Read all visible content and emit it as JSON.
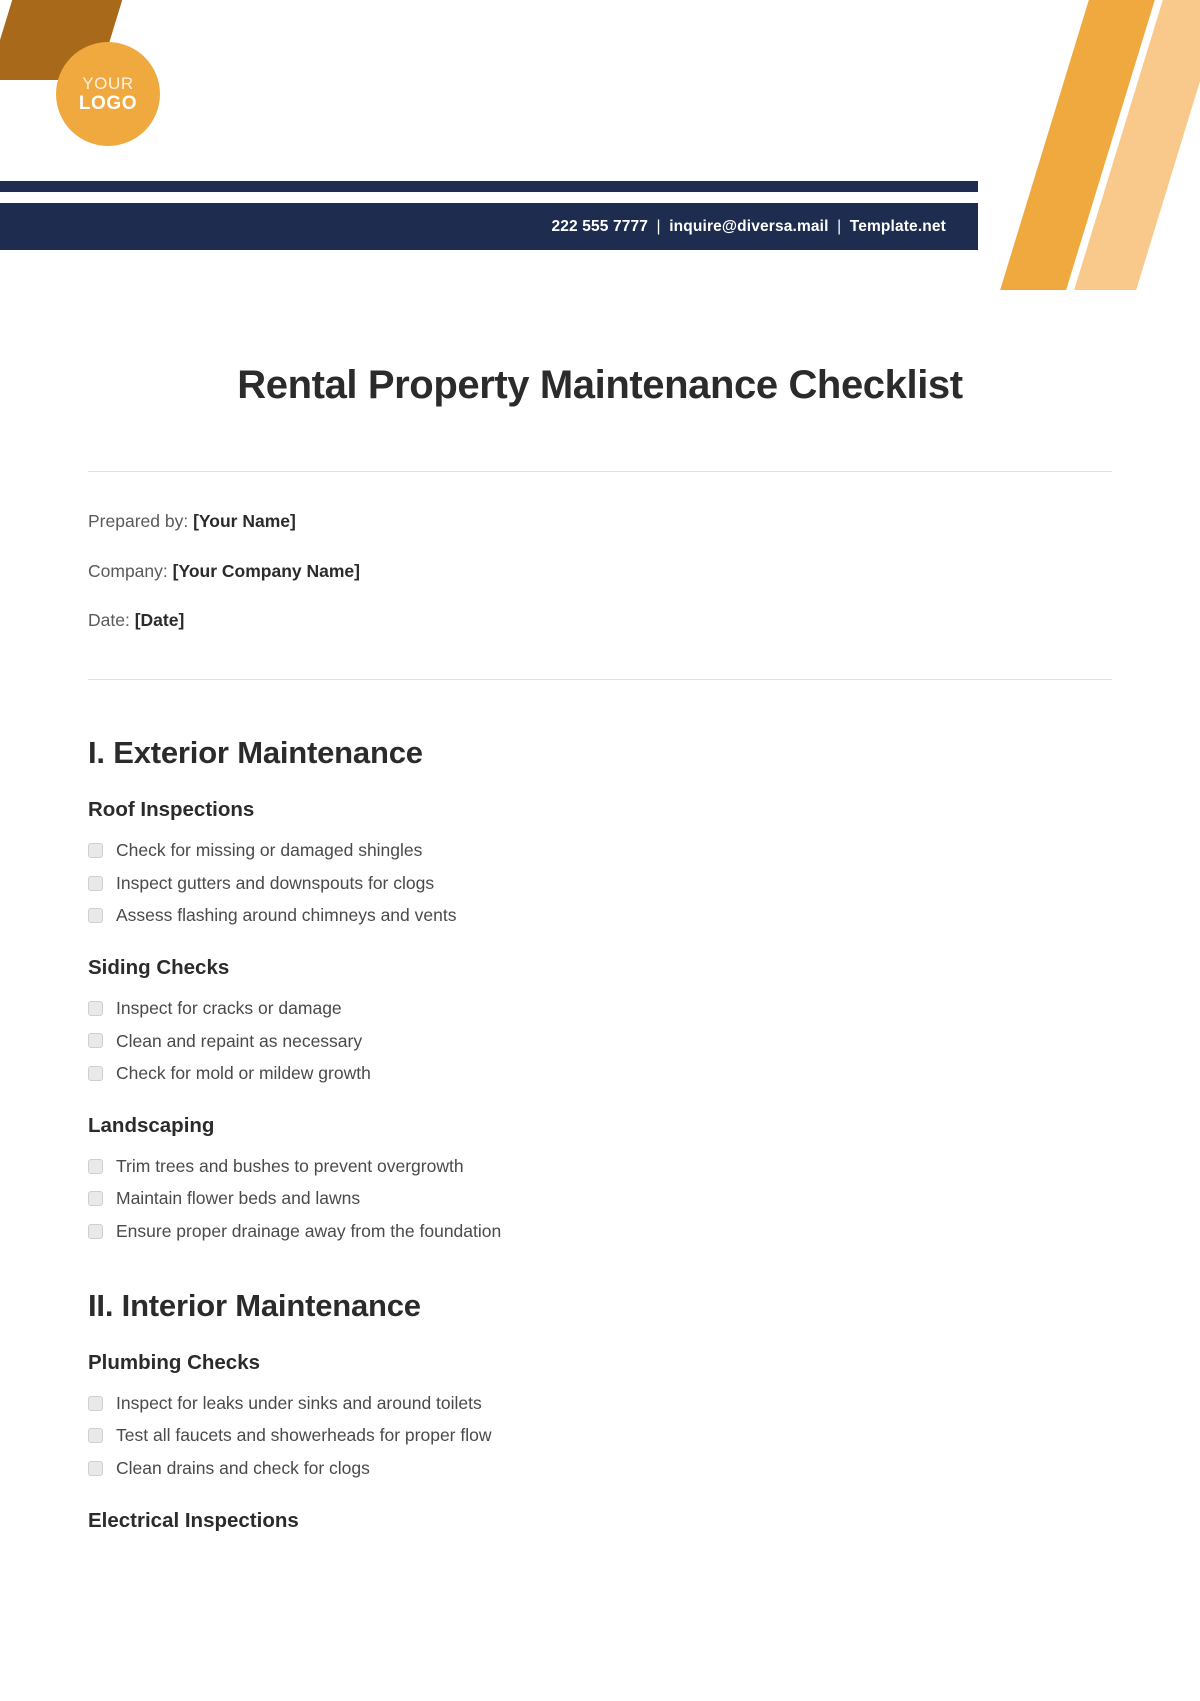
{
  "header": {
    "logo": {
      "line1": "YOUR",
      "line2": "LOGO"
    },
    "contact": {
      "phone": "222 555 7777",
      "email": "inquire@diversa.mail",
      "website": "Template.net",
      "separator": "|"
    },
    "colors": {
      "navy": "#1e2d4f",
      "orange": "#f0a93f",
      "tan": "#f8c98a",
      "amber": "#a8691a"
    }
  },
  "document": {
    "title": "Rental Property Maintenance Checklist",
    "meta": [
      {
        "label": "Prepared by:",
        "value": "[Your Name]"
      },
      {
        "label": "Company:",
        "value": "[Your Company Name]"
      },
      {
        "label": "Date:",
        "value": "[Date]"
      }
    ]
  },
  "sections": [
    {
      "title": "I. Exterior Maintenance",
      "groups": [
        {
          "title": "Roof Inspections",
          "items": [
            "Check for missing or damaged shingles",
            "Inspect gutters and downspouts for clogs",
            "Assess flashing around chimneys and vents"
          ]
        },
        {
          "title": "Siding Checks",
          "items": [
            "Inspect for cracks or damage",
            "Clean and repaint as necessary",
            "Check for mold or mildew growth"
          ]
        },
        {
          "title": "Landscaping",
          "items": [
            "Trim trees and bushes to prevent overgrowth",
            "Maintain flower beds and lawns",
            "Ensure proper drainage away from the foundation"
          ]
        }
      ]
    },
    {
      "title": "II. Interior Maintenance",
      "groups": [
        {
          "title": "Plumbing Checks",
          "items": [
            "Inspect for leaks under sinks and around toilets",
            "Test all faucets and showerheads for proper flow",
            "Clean drains and check for clogs"
          ]
        },
        {
          "title": "Electrical Inspections",
          "items": []
        }
      ]
    }
  ]
}
